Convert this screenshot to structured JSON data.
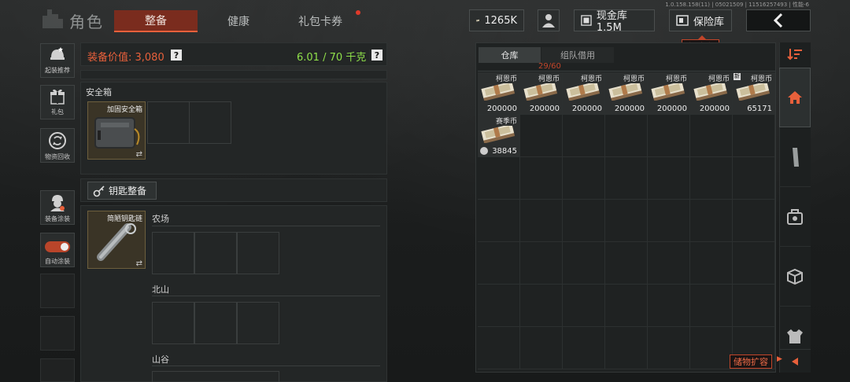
{
  "version": "1.0.158.158(11) | 05021509 | 11516257493 | 性能-6",
  "header": {
    "title": "角色",
    "tabs": [
      {
        "label": "整备",
        "active": true
      },
      {
        "label": "健康",
        "active": false
      },
      {
        "label": "礼包卡券",
        "active": false,
        "badge": true
      }
    ],
    "currency_value": "1265K",
    "cash_vault_label": "现金库 1.5M",
    "vault_label": "保险库",
    "vault_tip": "保险库"
  },
  "sidebar": {
    "items": [
      {
        "label": "起装推荐",
        "icon": "helmet-star-icon"
      },
      {
        "label": "礼包",
        "icon": "gift-icon"
      },
      {
        "label": "物资回收",
        "icon": "recycle-icon"
      },
      {
        "label": "装备涂装",
        "icon": "soldier-paint-icon"
      },
      {
        "label": "自动涂装",
        "icon": "toggle-icon"
      }
    ]
  },
  "loadout": {
    "value_label": "装备价值: 3,080",
    "weight_label": "6.01 / 70 千克",
    "safebox_title": "安全箱",
    "safebox_item": "加固安全箱",
    "keys_button": "钥匙整备",
    "key_item": "简陋钥匙链",
    "maps": [
      "农场",
      "北山",
      "山谷"
    ]
  },
  "warehouse": {
    "tabs": [
      {
        "label": "仓库",
        "active": true
      },
      {
        "label": "组队借用",
        "active": false
      }
    ],
    "capacity": "29/60",
    "items": [
      {
        "name": "柯恩币",
        "qty": "200000"
      },
      {
        "name": "柯恩币",
        "qty": "200000"
      },
      {
        "name": "柯恩币",
        "qty": "200000"
      },
      {
        "name": "柯恩币",
        "qty": "200000"
      },
      {
        "name": "柯恩币",
        "qty": "200000"
      },
      {
        "name": "柯恩币",
        "qty": "200000"
      },
      {
        "name": "柯恩币",
        "qty": "65171",
        "new_badge": "新"
      },
      {
        "name": "赛季币",
        "qty": "38845"
      }
    ],
    "expand_label": "储物扩容"
  },
  "colors": {
    "accent": "#e8603b",
    "weight_green": "#8fe04a",
    "value_orange": "#e8603b"
  }
}
